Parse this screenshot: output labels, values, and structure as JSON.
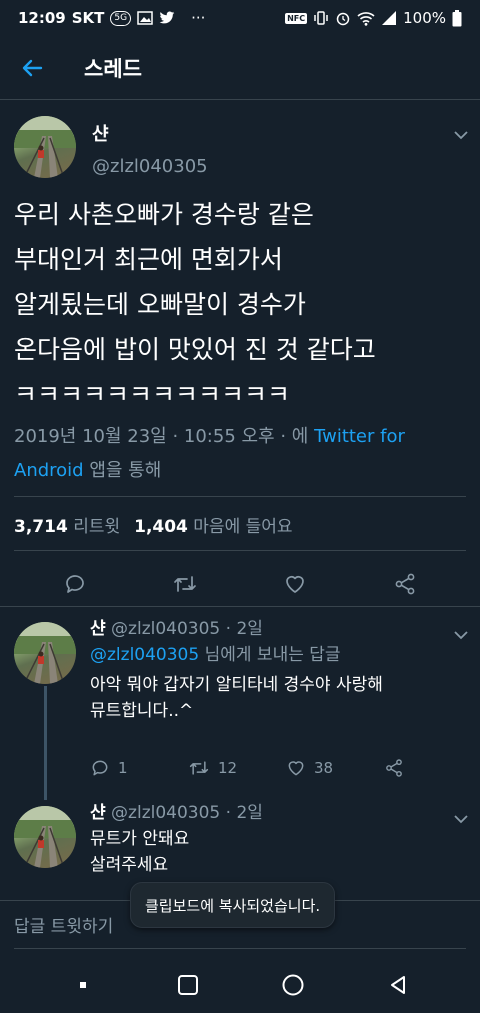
{
  "status_bar": {
    "time": "12:09",
    "carrier": "SKT",
    "badge": "5G",
    "nfc": "NFC",
    "battery": "100%"
  },
  "header": {
    "title": "스레드"
  },
  "main_tweet": {
    "name": "샨",
    "handle": "@zlzl040305",
    "text": "우리 사촌오빠가 경수랑 같은\n부대인거 최근에 면회가서\n알게됬는데 오빠말이 경수가\n온다음에 밥이 맛있어 진 것 같다고\nㅋㅋㅋㅋㅋㅋㅋㅋㅋㅋㅋㅋ",
    "timestamp": "2019년 10월 23일 · 10:55 오후 · 에 ",
    "source_link": "Twitter for Android",
    "source_suffix": " 앱을 통해",
    "retweet_count": "3,714",
    "retweet_label": "리트윗",
    "like_count": "1,404",
    "like_label": "마음에 들어요"
  },
  "replies": [
    {
      "name": "샨",
      "handle": "@zlzl040305 · 2일",
      "reply_to_link": "@zlzl040305",
      "reply_to_suffix": " 님에게 보내는 답글",
      "text_line1": "아악 뭐야 갑자기 알티타네 경수야 사랑해",
      "text_line2": "뮤트합니다..^",
      "reply_count": "1",
      "retweet_count": "12",
      "like_count": "38"
    },
    {
      "name": "샨",
      "handle": "@zlzl040305 · 2일",
      "text_line1": "뮤트가 안돼요",
      "text_line2": "살려주세요"
    }
  ],
  "compose": {
    "placeholder": "답글 트윗하기"
  },
  "toast": {
    "message": "클립보드에 복사되었습니다."
  },
  "colors": {
    "background": "#15202b",
    "accent": "#1da1f2",
    "muted": "#8899a6",
    "divider": "#38444d"
  }
}
